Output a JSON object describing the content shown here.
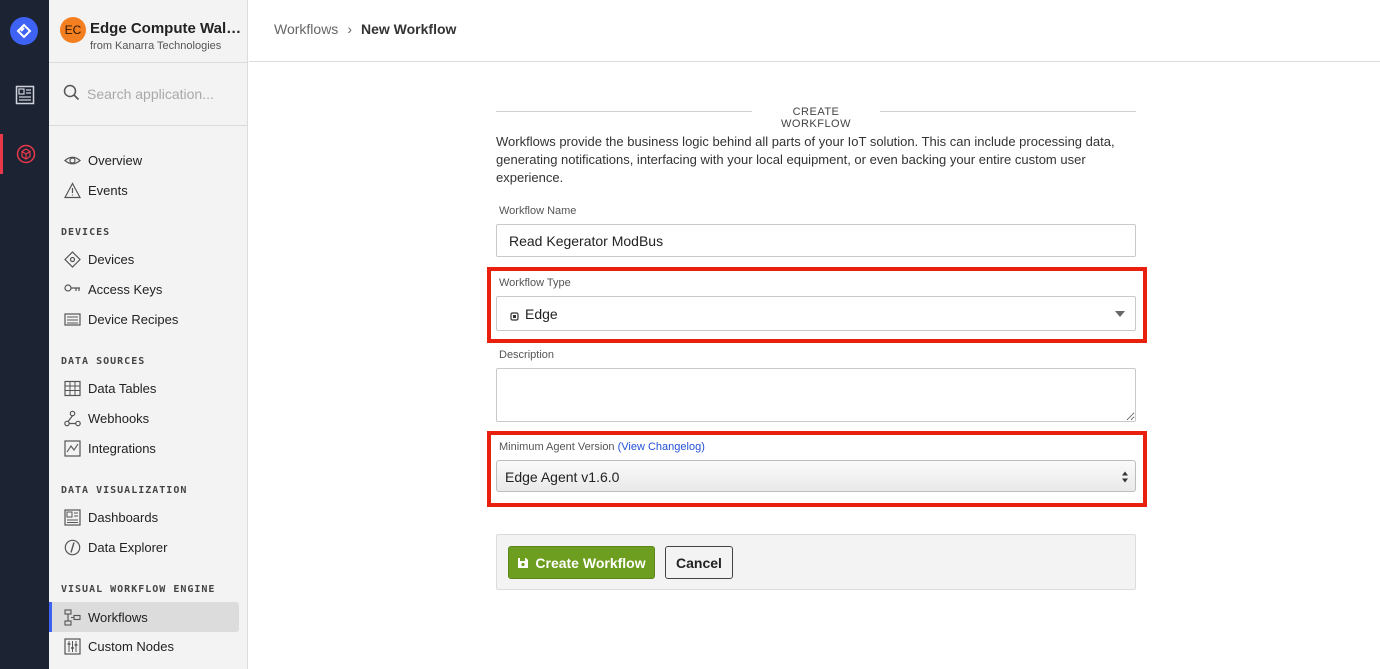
{
  "app": {
    "avatar_initials": "EC",
    "name": "Edge Compute Walkthrough",
    "org": "from Kanarra Technologies"
  },
  "search": {
    "placeholder": "Search application..."
  },
  "sidebar": {
    "items": [
      {
        "label": "Overview",
        "icon": "eye-icon"
      },
      {
        "label": "Events",
        "icon": "warning-icon"
      }
    ],
    "sections": [
      {
        "title": "DEVICES",
        "items": [
          {
            "label": "Devices",
            "icon": "diamond-icon"
          },
          {
            "label": "Access Keys",
            "icon": "key-icon"
          },
          {
            "label": "Device Recipes",
            "icon": "recipe-icon"
          }
        ]
      },
      {
        "title": "DATA SOURCES",
        "items": [
          {
            "label": "Data Tables",
            "icon": "table-icon"
          },
          {
            "label": "Webhooks",
            "icon": "webhook-icon"
          },
          {
            "label": "Integrations",
            "icon": "integration-icon"
          }
        ]
      },
      {
        "title": "DATA VISUALIZATION",
        "items": [
          {
            "label": "Dashboards",
            "icon": "dashboard-icon"
          },
          {
            "label": "Data Explorer",
            "icon": "explorer-icon"
          }
        ]
      },
      {
        "title": "VISUAL WORKFLOW ENGINE",
        "items": [
          {
            "label": "Workflows",
            "icon": "workflow-icon",
            "active": true
          },
          {
            "label": "Custom Nodes",
            "icon": "sliders-icon"
          }
        ]
      }
    ]
  },
  "breadcrumb": {
    "parent": "Workflows",
    "separator": "›",
    "current": "New Workflow"
  },
  "form": {
    "title": "CREATE WORKFLOW",
    "intro": "Workflows provide the business logic behind all parts of your IoT solution. This can include processing data, generating notifications, interfacing with your local equipment, or even backing your entire custom user experience.",
    "name_label": "Workflow Name",
    "name_value": "Read Kegerator ModBus",
    "type_label": "Workflow Type",
    "type_value": "Edge",
    "description_label": "Description",
    "description_value": "",
    "agent_label": "Minimum Agent Version",
    "agent_link": "(View Changelog)",
    "agent_value": "Edge Agent v1.6.0"
  },
  "actions": {
    "create_label": "Create Workflow",
    "cancel_label": "Cancel"
  },
  "colors": {
    "rail": "#1c2333",
    "accent": "#3e63f4",
    "primary_button": "#6e9e1f",
    "highlight": "#e8200d",
    "avatar": "#f47f20"
  }
}
